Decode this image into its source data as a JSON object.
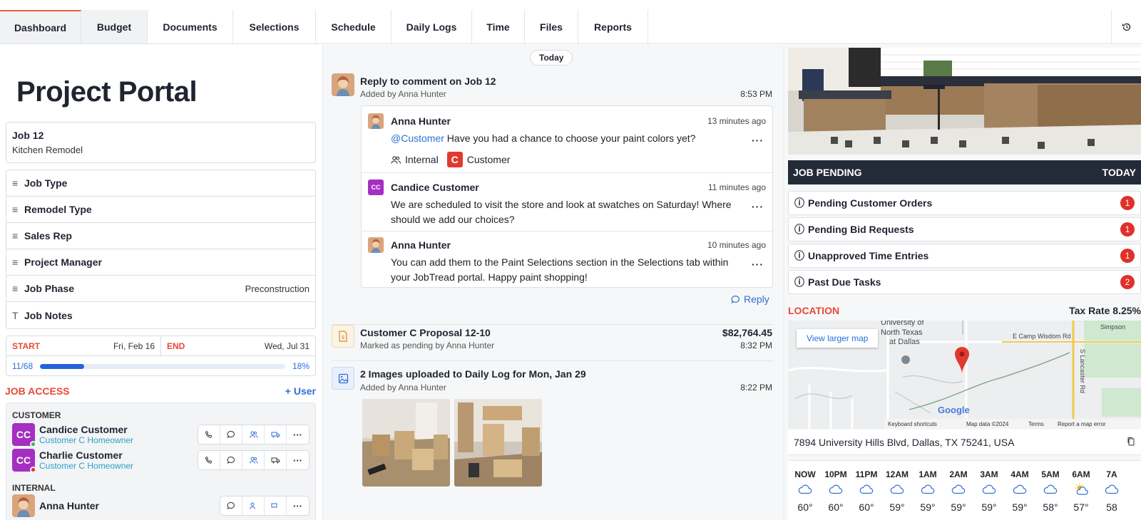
{
  "nav": {
    "tabs": [
      "Dashboard",
      "Budget",
      "Documents",
      "Selections",
      "Schedule",
      "Daily Logs",
      "Time",
      "Files",
      "Reports"
    ]
  },
  "left": {
    "title": "Project Portal",
    "job": {
      "name": "Job 12",
      "description": "Kitchen Remodel"
    },
    "fields": [
      {
        "label": "Job Type",
        "value": ""
      },
      {
        "label": "Remodel Type",
        "value": ""
      },
      {
        "label": "Sales Rep",
        "value": ""
      },
      {
        "label": "Project Manager",
        "value": ""
      },
      {
        "label": "Job Phase",
        "value": "Preconstruction"
      },
      {
        "label": "Job Notes",
        "value": ""
      }
    ],
    "dates": {
      "start_label": "START",
      "start_value": "Fri, Feb 16",
      "end_label": "END",
      "end_value": "Wed, Jul 31",
      "progress_count": "11/68",
      "progress_percent": "18%",
      "progress_fraction": 0.18
    },
    "access": {
      "title": "JOB ACCESS",
      "add_label": "+ User",
      "customer_group": "CUSTOMER",
      "customers": [
        {
          "initials": "CC",
          "name": "Candice Customer",
          "role": "Customer C Homeowner",
          "status_color": "#3bb54a"
        },
        {
          "initials": "CC",
          "name": "Charlie Customer",
          "role": "Customer C Homeowner",
          "status_color": "#e0302a"
        }
      ],
      "internal_group": "INTERNAL",
      "internal": [
        {
          "name": "Anna Hunter"
        }
      ]
    }
  },
  "feed": {
    "today_label": "Today",
    "item1": {
      "title": "Reply to comment on Job 12",
      "sub": "Added by Anna Hunter",
      "time": "8:53 PM",
      "comments": [
        {
          "name": "Anna Hunter",
          "ago": "13 minutes ago",
          "mention": "@Customer",
          "text": " Have you had a chance to choose your paint colors yet?"
        },
        {
          "initials": "CC",
          "name": "Candice Customer",
          "ago": "11 minutes ago",
          "text": "We are scheduled to visit the store and look at swatches on Saturday! Where should we add our choices?"
        },
        {
          "name": "Anna Hunter",
          "ago": "10 minutes ago",
          "text": "You can add them to the Paint Selections section in the Selections tab within your JobTread portal. Happy paint shopping!"
        }
      ],
      "tag_internal": "Internal",
      "tag_customer_letter": "C",
      "tag_customer": "Customer",
      "reply_label": "Reply"
    },
    "item2": {
      "title": "Customer C Proposal 12-10",
      "sub": "Marked as pending by Anna Hunter",
      "amount": "$82,764.45",
      "time": "8:32 PM"
    },
    "item3": {
      "title": "2 Images uploaded to Daily Log for Mon, Jan 29",
      "sub": "Added by Anna Hunter",
      "time": "8:22 PM"
    }
  },
  "right": {
    "status": "JOB PENDING",
    "status_date": "TODAY",
    "pending_items": [
      {
        "label": "Pending Customer Orders",
        "count": "1"
      },
      {
        "label": "Pending Bid Requests",
        "count": "1"
      },
      {
        "label": "Unapproved Time Entries",
        "count": "1"
      },
      {
        "label": "Past Due Tasks",
        "count": "2"
      }
    ],
    "location_label": "LOCATION",
    "tax_rate": "Tax Rate 8.25%",
    "map": {
      "view_larger": "View larger map",
      "labels": [
        "University of",
        "North Texas",
        "at Dallas",
        "E Camp Wisdom Rd",
        "Simpson",
        "S Lancaster Rd",
        "Google",
        "Keyboard shortcuts",
        "Map data ©2024",
        "Terms",
        "Report a map error"
      ]
    },
    "address": "7894 University Hills Blvd, Dallas, TX 75241, USA",
    "weather": [
      {
        "hour": "NOW",
        "temp": "60°",
        "icon": "cloud-icon"
      },
      {
        "hour": "10PM",
        "temp": "60°",
        "icon": "cloud-icon"
      },
      {
        "hour": "11PM",
        "temp": "60°",
        "icon": "cloud-icon"
      },
      {
        "hour": "12AM",
        "temp": "59°",
        "icon": "cloud-icon"
      },
      {
        "hour": "1AM",
        "temp": "59°",
        "icon": "cloud-icon"
      },
      {
        "hour": "2AM",
        "temp": "59°",
        "icon": "cloud-icon"
      },
      {
        "hour": "3AM",
        "temp": "59°",
        "icon": "cloud-icon"
      },
      {
        "hour": "4AM",
        "temp": "59°",
        "icon": "cloud-icon"
      },
      {
        "hour": "5AM",
        "temp": "58°",
        "icon": "cloud-icon"
      },
      {
        "hour": "6AM",
        "temp": "57°",
        "icon": "partly-sunny-icon"
      },
      {
        "hour": "7A",
        "temp": "58",
        "icon": "cloud-icon"
      }
    ]
  }
}
